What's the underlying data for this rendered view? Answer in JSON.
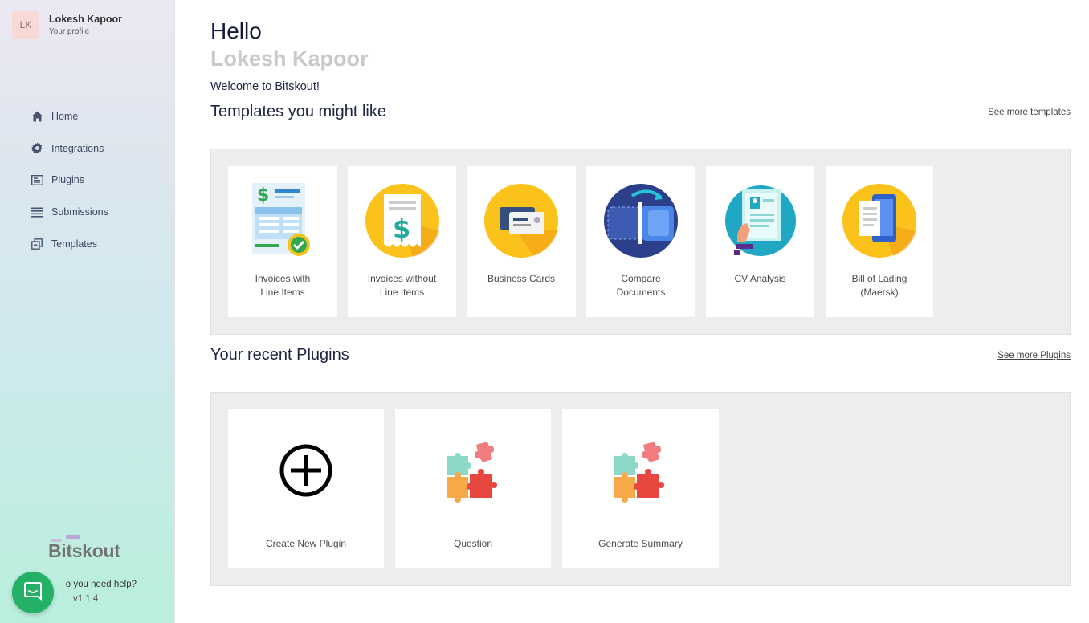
{
  "sidebar": {
    "profile": {
      "initials": "LK",
      "name": "Lokesh Kapoor",
      "subtitle": "Your profile"
    },
    "nav": [
      {
        "label": "Home",
        "icon": "home-icon"
      },
      {
        "label": "Integrations",
        "icon": "gear-icon"
      },
      {
        "label": "Plugins",
        "icon": "plugin-icon"
      },
      {
        "label": "Submissions",
        "icon": "list-icon"
      },
      {
        "label": "Templates",
        "icon": "templates-icon"
      }
    ],
    "brand": "Bitskout",
    "help_prefix": "o you need ",
    "help_link": "help?",
    "version": "v1.1.4"
  },
  "main": {
    "greeting": "Hello",
    "user_name": "Lokesh Kapoor",
    "welcome": "Welcome to Bitskout!",
    "templates_title": "Templates you might like",
    "templates_link": "See more templates",
    "templates": [
      {
        "line1": "Invoices with",
        "line2": "Line Items",
        "icon": "invoice-line-items-icon"
      },
      {
        "line1": "Invoices without",
        "line2": "Line Items",
        "icon": "receipt-icon"
      },
      {
        "line1": "Business Cards",
        "line2": "",
        "icon": "business-card-icon"
      },
      {
        "line1": "Compare",
        "line2": "Documents",
        "icon": "compare-documents-icon"
      },
      {
        "line1": "CV Analysis",
        "line2": "",
        "icon": "cv-icon"
      },
      {
        "line1": "Bill of Lading",
        "line2": "(Maersk)",
        "icon": "bill-of-lading-icon"
      }
    ],
    "plugins_title": "Your recent Plugins",
    "plugins_link": "See more Plugins",
    "plugins": [
      {
        "label": "Create New Plugin",
        "icon": "plus-circle-icon"
      },
      {
        "label": "Question",
        "icon": "puzzle-icon"
      },
      {
        "label": "Generate Summary",
        "icon": "puzzle-icon"
      }
    ]
  },
  "colors": {
    "accent_green": "#25b067",
    "title_navy": "#1c2440",
    "muted_name": "#c9c9c9",
    "yellow": "#fbc21b",
    "navy_icon": "#2b3f8a"
  }
}
